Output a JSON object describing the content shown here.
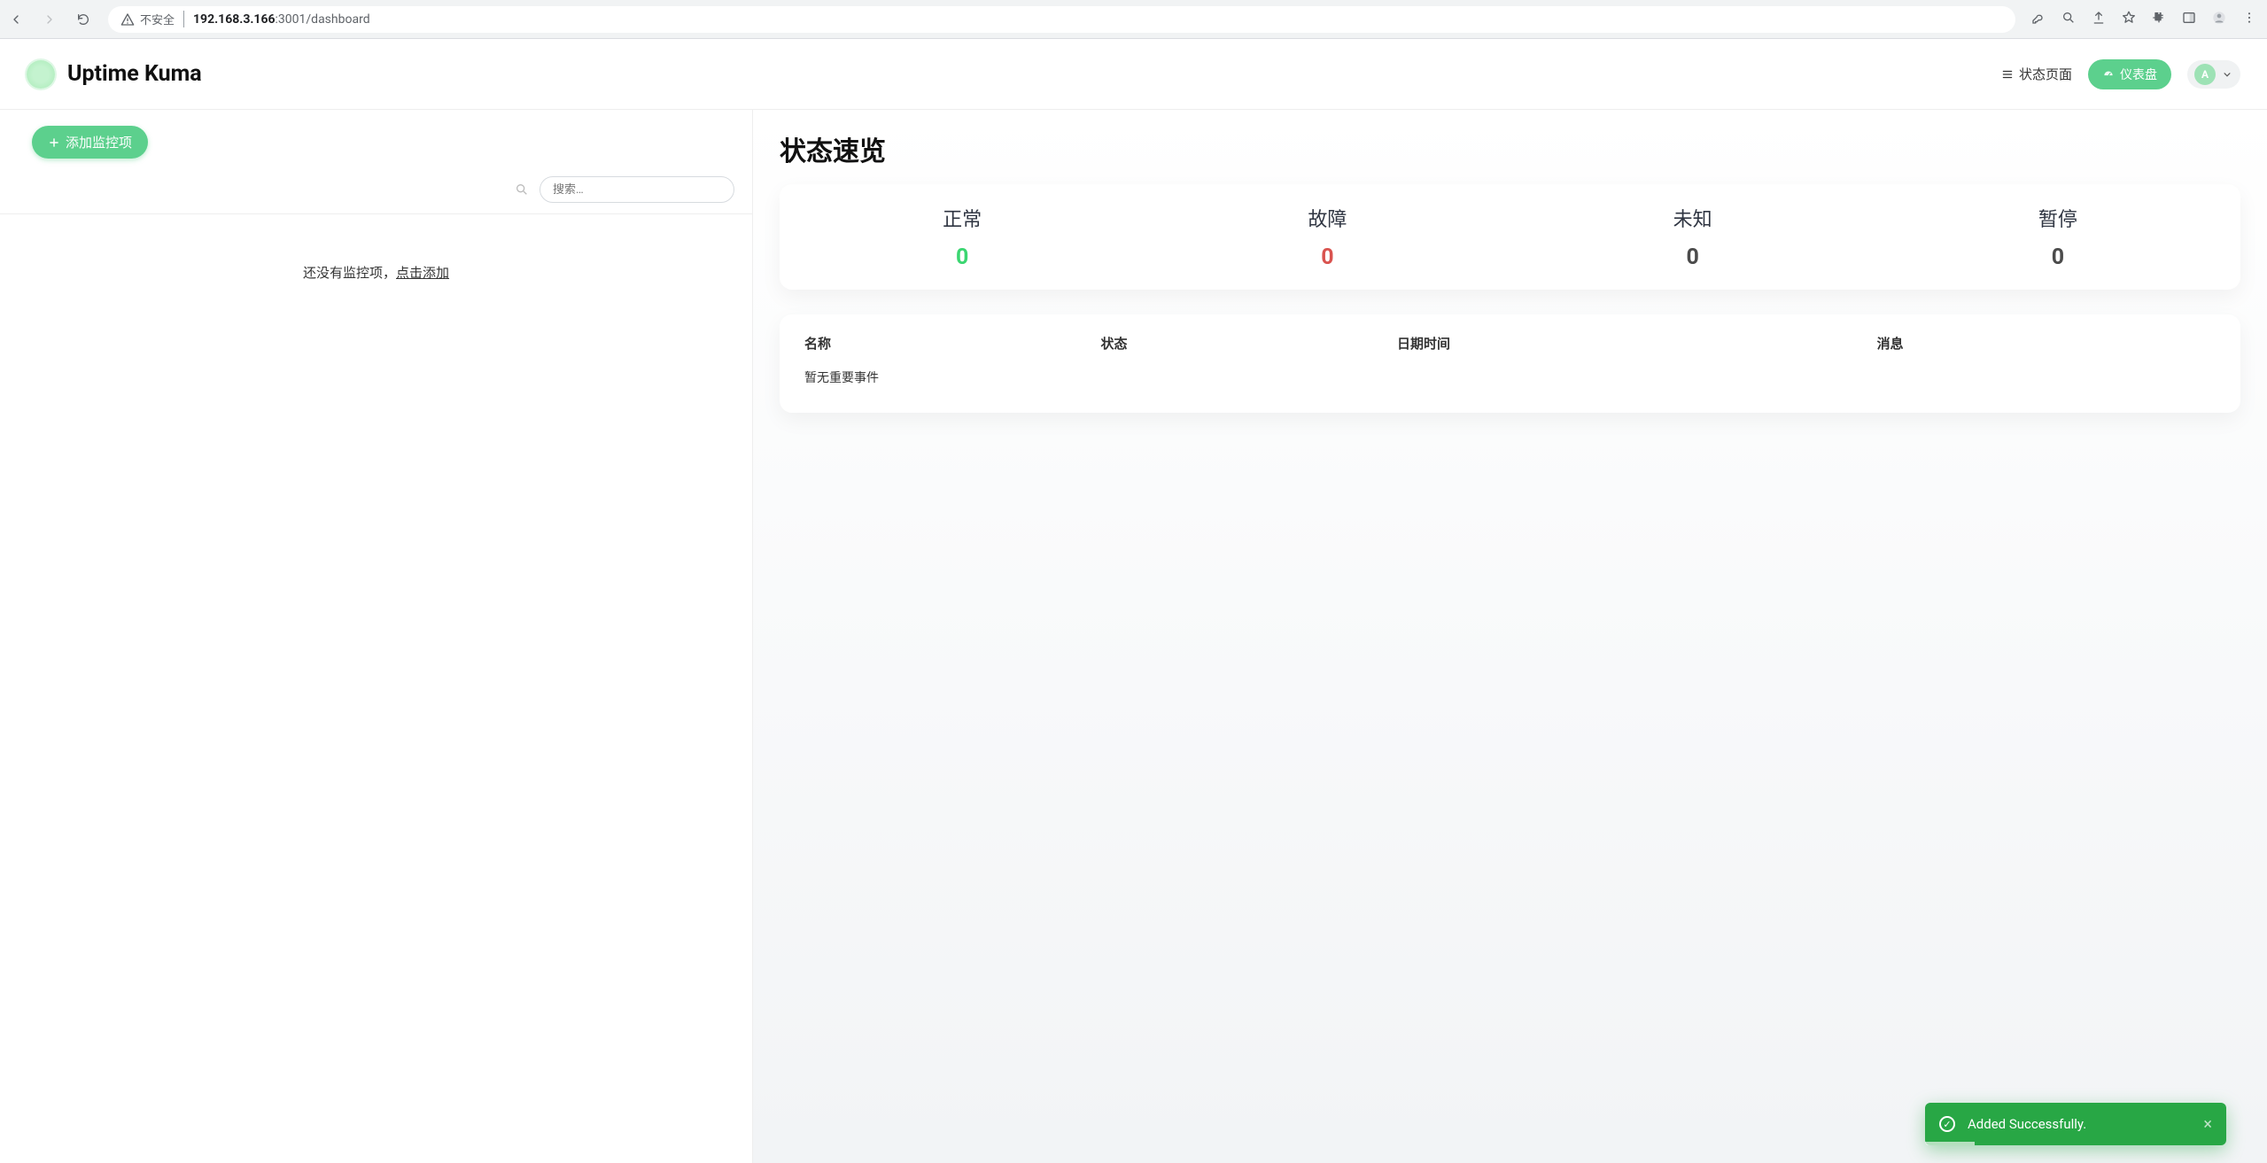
{
  "browser": {
    "insecure_label": "不安全",
    "url_host": "192.168.3.166",
    "url_rest": ":3001/dashboard"
  },
  "header": {
    "title": "Uptime Kuma",
    "status_page_label": "状态页面",
    "dashboard_label": "仪表盘",
    "avatar_letter": "A"
  },
  "sidebar": {
    "add_label": "添加监控项",
    "search_placeholder": "搜索…",
    "empty_prefix": "还没有监控项，",
    "empty_link": "点击添加"
  },
  "overview": {
    "title": "状态速览",
    "stats": [
      {
        "label": "正常",
        "value": "0",
        "cls": "up"
      },
      {
        "label": "故障",
        "value": "0",
        "cls": "down"
      },
      {
        "label": "未知",
        "value": "0",
        "cls": ""
      },
      {
        "label": "暂停",
        "value": "0",
        "cls": ""
      }
    ],
    "table": {
      "cols": {
        "name": "名称",
        "status": "状态",
        "date": "日期时间",
        "msg": "消息"
      },
      "empty": "暂无重要事件"
    }
  },
  "toast": {
    "text": "Added Successfully."
  }
}
